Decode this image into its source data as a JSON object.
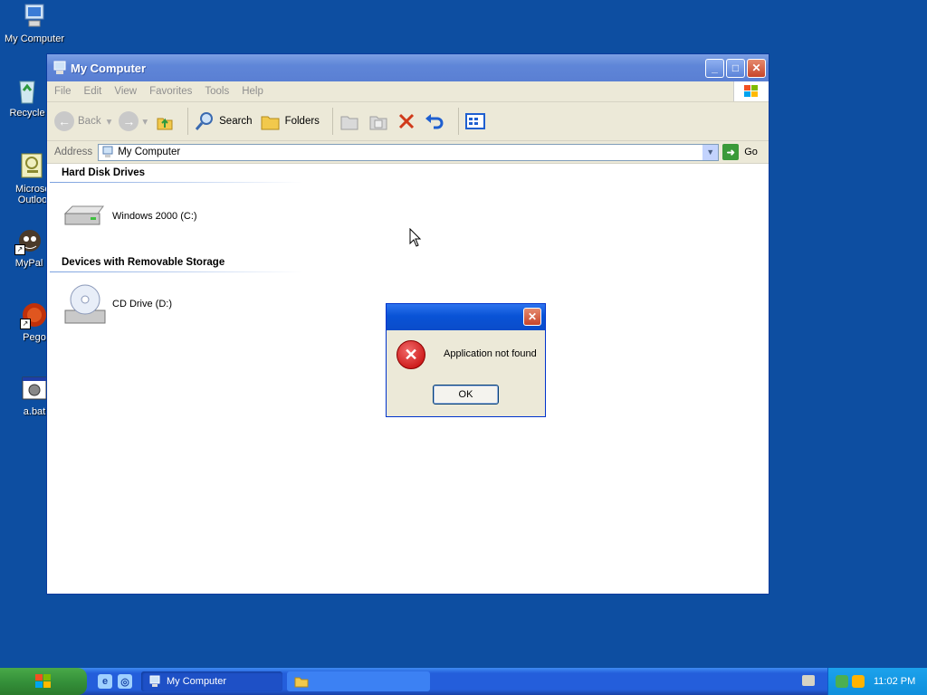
{
  "desktop": {
    "icons": [
      {
        "label": "My Computer",
        "icon": "my-computer-icon"
      },
      {
        "label": "Recycle",
        "icon": "recycle-bin-icon"
      },
      {
        "label": "Microsc",
        "label2": "Outloo",
        "icon": "outlook-icon"
      },
      {
        "label": "MyPal",
        "icon": "mypal-icon"
      },
      {
        "label": "Pego",
        "icon": "pego-icon"
      },
      {
        "label": "a.bat",
        "icon": "batch-file-icon"
      }
    ]
  },
  "window": {
    "title": "My Computer",
    "menu": [
      "File",
      "Edit",
      "View",
      "Favorites",
      "Tools",
      "Help"
    ],
    "toolbar": {
      "back": "Back",
      "search": "Search",
      "folders": "Folders"
    },
    "address": {
      "label": "Address",
      "value": "My Computer",
      "go": "Go"
    },
    "sections": [
      {
        "title": "Hard Disk Drives",
        "items": [
          {
            "label": "Windows 2000 (C:)",
            "icon": "hard-disk-icon"
          }
        ]
      },
      {
        "title": "Devices with Removable Storage",
        "items": [
          {
            "label": "CD Drive (D:)",
            "icon": "cd-drive-icon"
          }
        ]
      }
    ]
  },
  "dialog": {
    "message": "Application not found",
    "ok": "OK"
  },
  "taskbar": {
    "tasks": [
      {
        "label": "My Computer"
      },
      {
        "label": ""
      }
    ],
    "clock": "11:02 PM"
  },
  "colors": {
    "desktop": "#0d4ea1",
    "taskbar": "#245edb",
    "dialog_title": "#0953d6",
    "error": "#c00000"
  }
}
